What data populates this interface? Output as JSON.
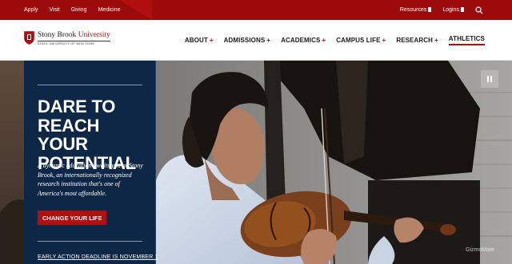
{
  "utility_bar": {
    "links": [
      "Apply",
      "Visit",
      "Giving",
      "Medicine"
    ],
    "right_links": [
      "Resources",
      "Logins"
    ],
    "search_icon": "search-icon",
    "color": "#9b0b0b"
  },
  "header": {
    "logo": {
      "name_part1": "Stony Brook",
      "name_part2": "University",
      "subtitle": "STATE UNIVERSITY OF NEW YORK",
      "icon": "shield-icon"
    },
    "nav": [
      {
        "label": "ABOUT",
        "plus": "+"
      },
      {
        "label": "ADMISSIONS",
        "plus": "+"
      },
      {
        "label": "ACADEMICS",
        "plus": "+"
      },
      {
        "label": "CAMPUS LIFE",
        "plus": "+"
      },
      {
        "label": "RESEARCH",
        "plus": "+"
      },
      {
        "label": "ATHLETICS",
        "plus": ""
      }
    ],
    "accent": "#b10f0f"
  },
  "hero": {
    "headline": "Dare to Reach Your Potential",
    "intro": "A dynamic education awaits you at Stony Brook, an internationally recognized research institution that's one of America's most affordable.",
    "cta_label": "CHANGE YOUR LIFE",
    "deadline": "EARLY ACTION DEADLINE IS NOVEMBER 1",
    "pause_icon": "pause-icon",
    "panel_color": "#0f2746",
    "watermark": "GizmoMate"
  }
}
